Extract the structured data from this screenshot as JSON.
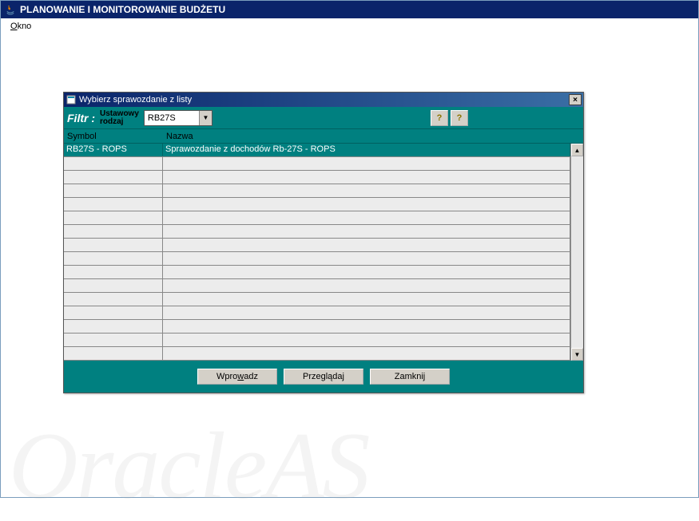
{
  "main_window": {
    "title": "PLANOWANIE I MONITOROWANIE BUDŻETU"
  },
  "menu": {
    "okno": "Okno",
    "okno_mnemonic": "O"
  },
  "dialog": {
    "title": "Wybierz sprawozdanie z listy",
    "close_symbol": "×"
  },
  "filter": {
    "label": "Filtr :",
    "field_label_line1": "Ustawowy",
    "field_label_line2": "rodzaj",
    "dropdown_value": "RB27S"
  },
  "table": {
    "columns": {
      "symbol": "Symbol",
      "nazwa": "Nazwa"
    },
    "rows": [
      {
        "symbol": "RB27S - ROPS",
        "nazwa": "Sprawozdanie z dochodów Rb-27S - ROPS",
        "selected": true
      },
      {
        "symbol": "",
        "nazwa": "",
        "selected": false
      },
      {
        "symbol": "",
        "nazwa": "",
        "selected": false
      },
      {
        "symbol": "",
        "nazwa": "",
        "selected": false
      },
      {
        "symbol": "",
        "nazwa": "",
        "selected": false
      },
      {
        "symbol": "",
        "nazwa": "",
        "selected": false
      },
      {
        "symbol": "",
        "nazwa": "",
        "selected": false
      },
      {
        "symbol": "",
        "nazwa": "",
        "selected": false
      },
      {
        "symbol": "",
        "nazwa": "",
        "selected": false
      },
      {
        "symbol": "",
        "nazwa": "",
        "selected": false
      },
      {
        "symbol": "",
        "nazwa": "",
        "selected": false
      },
      {
        "symbol": "",
        "nazwa": "",
        "selected": false
      },
      {
        "symbol": "",
        "nazwa": "",
        "selected": false
      },
      {
        "symbol": "",
        "nazwa": "",
        "selected": false
      },
      {
        "symbol": "",
        "nazwa": "",
        "selected": false
      },
      {
        "symbol": "",
        "nazwa": "",
        "selected": false
      }
    ]
  },
  "buttons": {
    "wprowadz": "Wprowadz",
    "przegladaj": "Przeglądaj",
    "zamknij": "Zamknij"
  },
  "scrollbar": {
    "up": "▲",
    "down": "▼"
  },
  "dropdown_arrow": "▼",
  "help_symbol": "?",
  "watermark": "OracleAS"
}
